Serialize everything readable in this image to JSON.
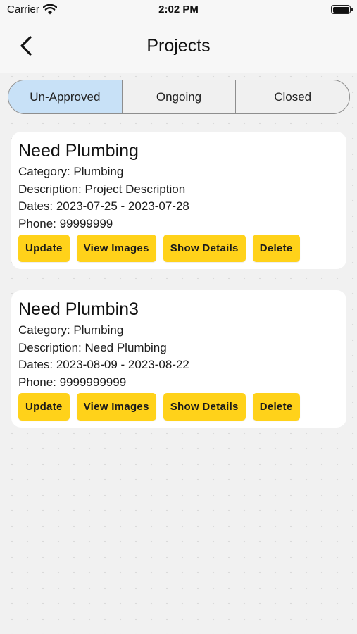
{
  "status_bar": {
    "carrier": "Carrier",
    "time": "2:02 PM"
  },
  "header": {
    "title": "Projects",
    "back_icon": "chevron-left-icon"
  },
  "tabs": [
    {
      "label": "Un-Approved",
      "active": true
    },
    {
      "label": "Ongoing",
      "active": false
    },
    {
      "label": "Closed",
      "active": false
    }
  ],
  "colors": {
    "active_tab": "#c8e1f7",
    "button": "#ffd21a",
    "card": "#ffffff",
    "background": "#f1f1f1"
  },
  "projects": [
    {
      "title": "Need Plumbing",
      "category": "Category: Plumbing",
      "description": "Description: Project Description",
      "dates": "Dates: 2023-07-25 - 2023-07-28",
      "phone": "Phone: 99999999",
      "buttons": {
        "update": "Update",
        "view_images": "View Images",
        "show_details": "Show Details",
        "delete": "Delete"
      }
    },
    {
      "title": "Need Plumbin3",
      "category": "Category: Plumbing",
      "description": "Description: Need Plumbing",
      "dates": "Dates: 2023-08-09 - 2023-08-22",
      "phone": "Phone: 9999999999",
      "buttons": {
        "update": "Update",
        "view_images": "View Images",
        "show_details": "Show Details",
        "delete": "Delete"
      }
    }
  ]
}
